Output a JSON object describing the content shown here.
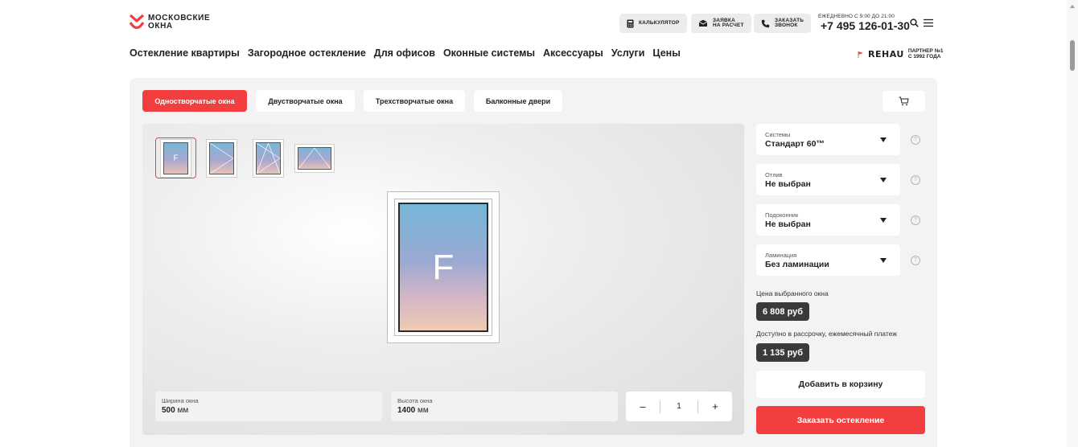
{
  "header": {
    "logo_line1": "МОСКОВСКИЕ",
    "logo_line2": "ОКНА",
    "calc_label": "КАЛЬКУЛЯТОР",
    "request_line1": "ЗАЯВКА",
    "request_line2": "НА РАСЧЕТ",
    "call_line1": "ЗАКАЗАТЬ",
    "call_line2": "ЗВОНОК",
    "work_hours": "ЕЖЕДНЕВНО С 9:00 ДО 21:00",
    "phone": "+7 495 126-01-30"
  },
  "nav": {
    "items": [
      {
        "label": "Остекление квартиры"
      },
      {
        "label": "Загородное остекление"
      },
      {
        "label": "Для офисов"
      },
      {
        "label": "Оконные системы"
      },
      {
        "label": "Аксессуары"
      },
      {
        "label": "Услуги"
      },
      {
        "label": "Цены"
      }
    ]
  },
  "partner": {
    "brand": "REHAU",
    "line1": "ПАРТНЕР №1",
    "line2": "С 1992 ГОДА"
  },
  "tabs": [
    {
      "label": "Одностворчатые окна",
      "active": true
    },
    {
      "label": "Двустворчатые окна",
      "active": false
    },
    {
      "label": "Трехстворчатые окна",
      "active": false
    },
    {
      "label": "Балконные двери",
      "active": false
    }
  ],
  "preview": {
    "sash_letter": "F",
    "thumb_letter": "F"
  },
  "dimensions": {
    "width_label": "Ширина окна",
    "width_value": "500",
    "height_label": "Высота окна",
    "height_value": "1400",
    "unit": "мм"
  },
  "quantity": {
    "minus": "–",
    "value": "1",
    "plus": "+"
  },
  "options": [
    {
      "label": "Системы",
      "value": "Стандарт 60™"
    },
    {
      "label": "Отлив",
      "value": "Не выбран"
    },
    {
      "label": "Подоконник",
      "value": "Не выбран"
    },
    {
      "label": "Ламинация",
      "value": "Без ламинации"
    }
  ],
  "help_glyph": "?",
  "price": {
    "label": "Цена выбранного окна",
    "value": "6 808 руб",
    "installment_label": "Доступно в рассрочку, ежемесячный платеж",
    "installment_value": "1 135 руб"
  },
  "actions": {
    "add_to_cart": "Добавить в корзину",
    "order": "Заказать остекление"
  },
  "colors": {
    "accent": "#f23e3e",
    "dark_badge": "#3a3a3a",
    "panel_bg": "#f3f3f3"
  }
}
